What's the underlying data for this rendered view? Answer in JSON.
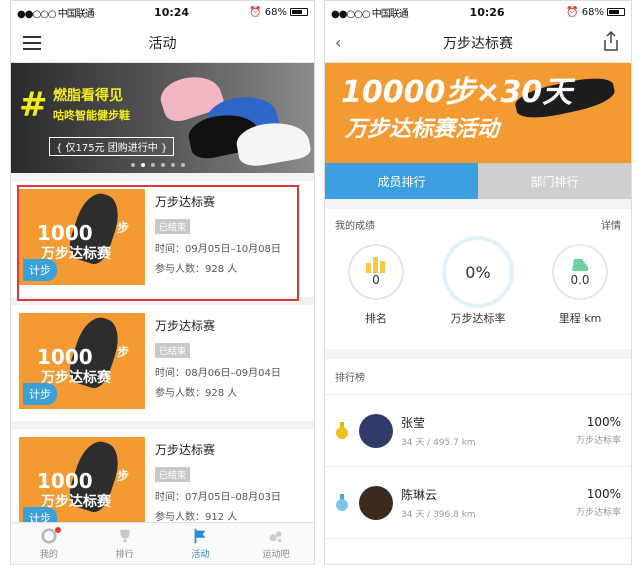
{
  "left": {
    "status": {
      "carrier": "●●○○○ 中国联通",
      "time": "10:24",
      "battery": "68%"
    },
    "nav": {
      "title": "活动"
    },
    "banner": {
      "line1": "燃脂看得见",
      "line2": "咕咚智能健步鞋",
      "line3": "{ 仅175元 团购进行中 }"
    },
    "thumb": {
      "big": "1000",
      "unit": "步",
      "sub": "万步达标赛",
      "badge": "计步"
    },
    "events": [
      {
        "name": "万步达标赛",
        "status": "已结束",
        "time": "时间：09月05日–10月08日",
        "people": "参与人数：928 人"
      },
      {
        "name": "万步达标赛",
        "status": "已结束",
        "time": "时间：08月06日–09月04日",
        "people": "参与人数：928 人"
      },
      {
        "name": "万步达标赛",
        "status": "已结束",
        "time": "时间：07月05日–08月03日",
        "people": "参与人数：912 人"
      }
    ],
    "tabs": [
      {
        "label": "我的"
      },
      {
        "label": "排行"
      },
      {
        "label": "活动"
      },
      {
        "label": "运动吧"
      }
    ]
  },
  "right": {
    "status": {
      "carrier": "●●○○○ 中国联通",
      "time": "10:26",
      "battery": "68%"
    },
    "nav": {
      "title": "万步达标赛"
    },
    "hero": {
      "line1": "10000步×30天",
      "line2": "万步达标赛活动"
    },
    "tabs": [
      {
        "label": "成员排行"
      },
      {
        "label": "部门排行"
      }
    ],
    "performance": {
      "header": "我的成绩",
      "detail": "详情",
      "stats": [
        {
          "value": "0",
          "label": "排名"
        },
        {
          "value": "0%",
          "label": "万步达标率"
        },
        {
          "value": "0.0",
          "label": "里程 km"
        }
      ]
    },
    "ranking": {
      "header": "排行榜",
      "rows": [
        {
          "name": "张莹",
          "sub": "34 天 / 495.7 km",
          "pct": "100%",
          "pct_label": "万步达标率"
        },
        {
          "name": "陈琳云",
          "sub": "34 天 / 396.8 km",
          "pct": "100%",
          "pct_label": "万步达标率"
        }
      ]
    }
  },
  "colors": {
    "accent": "#2a8ad8",
    "orange": "#f39a33",
    "highlight": "#d93b3b"
  }
}
